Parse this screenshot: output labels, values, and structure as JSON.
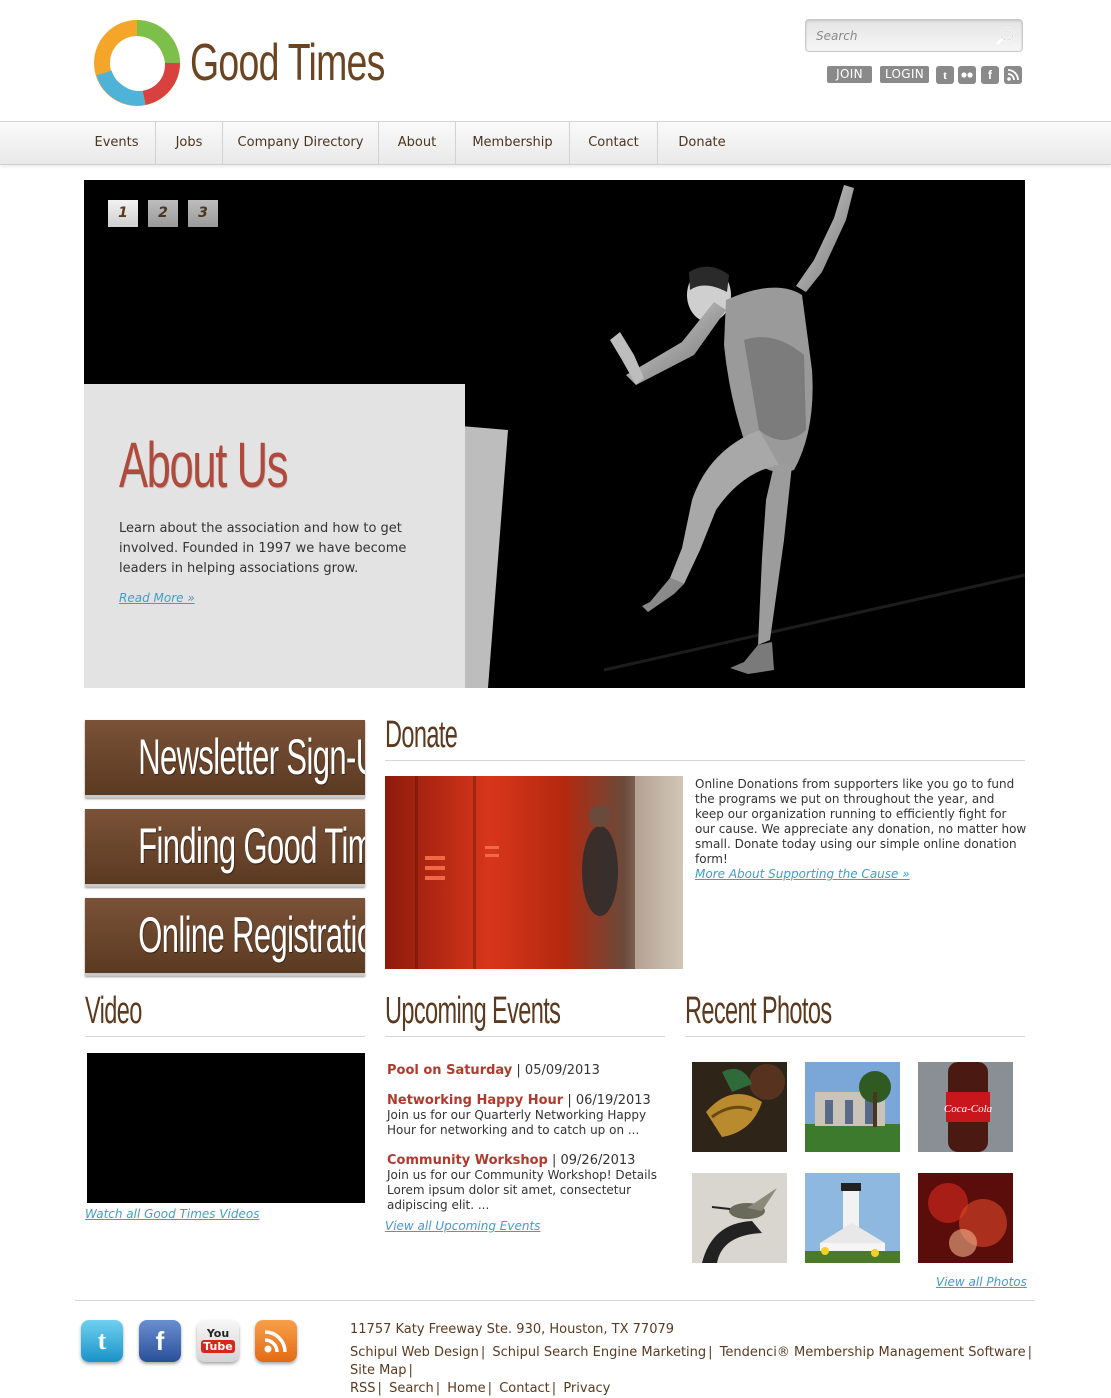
{
  "brand": {
    "name": "Good Times",
    "colors": {
      "orange": "#f4a52a",
      "green": "#7cbf4a",
      "blue": "#4fb3d8",
      "red": "#d8413d",
      "brown": "#6b4422"
    }
  },
  "search": {
    "placeholder": "Search"
  },
  "account": {
    "join_label": "JOIN",
    "login_label": "LOGIN"
  },
  "social_header": [
    "twitter-icon",
    "flickr-icon",
    "facebook-icon",
    "rss-icon"
  ],
  "nav": {
    "items": [
      {
        "label": "Events"
      },
      {
        "label": "Jobs"
      },
      {
        "label": "Company Directory"
      },
      {
        "label": "About"
      },
      {
        "label": "Membership"
      },
      {
        "label": "Contact"
      },
      {
        "label": "Donate"
      }
    ]
  },
  "hero": {
    "slides": [
      "1",
      "2",
      "3"
    ],
    "active_slide": "1",
    "title": "About Us",
    "text": "Learn about the association and how to get involved. Founded in 1997 we have become leaders in helping associations grow.",
    "link": "Read More »"
  },
  "buttons": {
    "newsletter": "Newsletter Sign-Up",
    "finding": "Finding Good Times",
    "registration": "Online Registration"
  },
  "donate": {
    "title": "Donate",
    "text": "Online Donations from supporters like you go to fund the programs we put on throughout the year, and keep our organization running to efficiently fight for our cause. We appreciate any donation, no matter how small. Donate today using our simple online donation form!",
    "link": "More About Supporting the Cause »"
  },
  "video": {
    "title": "Video",
    "link": "Watch all Good Times Videos"
  },
  "events": {
    "title": "Upcoming Events",
    "items": [
      {
        "name": "Pool on Saturday",
        "date": "05/09/2013",
        "desc": ""
      },
      {
        "name": "Networking Happy Hour",
        "date": "06/19/2013",
        "desc": "Join us for our Quarterly Networking Happy Hour for networking and to catch up on ..."
      },
      {
        "name": "Community Workshop",
        "date": "09/26/2013",
        "desc": "Join us for our Community Workshop! Details Lorem ipsum dolor sit amet, consectetur adipiscing elit. ..."
      }
    ],
    "separator": " | ",
    "link": "View all Upcoming Events"
  },
  "photos": {
    "title": "Recent Photos",
    "link": "View all Photos"
  },
  "footer": {
    "social": [
      "twitter-icon",
      "facebook-icon",
      "youtube-icon",
      "rss-icon"
    ],
    "youtube_top": "You",
    "youtube_bottom": "Tube",
    "address": "11757 Katy Freeway Ste. 930, Houston, TX 77079",
    "links": [
      "Schipul Web Design",
      "Schipul Search Engine Marketing",
      "Tendenci® Membership Management Software",
      "Site Map",
      "RSS",
      "Search",
      "Home",
      "Contact",
      "Privacy"
    ],
    "separator": "|"
  }
}
